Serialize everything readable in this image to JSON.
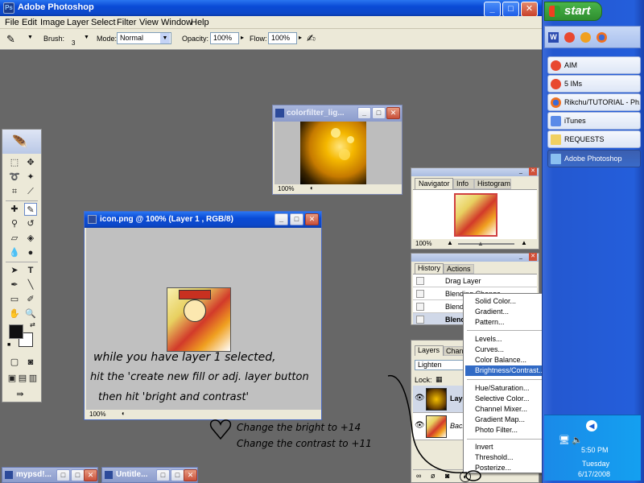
{
  "app": {
    "title": "Adobe Photoshop",
    "menu": [
      "File",
      "Edit",
      "Image",
      "Layer",
      "Select",
      "Filter",
      "View",
      "Window",
      "Help"
    ]
  },
  "options_bar": {
    "brush_label": "Brush:",
    "brush_size": "3",
    "mode_label": "Mode:",
    "mode_value": "Normal",
    "opacity_label": "Opacity:",
    "opacity_value": "100%",
    "flow_label": "Flow:",
    "flow_value": "100%"
  },
  "colorfilter_window": {
    "title": "colorfilter_lig...",
    "zoom": "100%"
  },
  "icon_window": {
    "title": "icon.png @ 100% (Layer 1 , RGB/8)",
    "zoom": "100%"
  },
  "navigator": {
    "tabs": [
      "Navigator",
      "Info",
      "Histogram"
    ],
    "zoom": "100%"
  },
  "history": {
    "tabs": [
      "History",
      "Actions"
    ],
    "items": [
      "Drag Layer",
      "Blending Change",
      "Blend",
      "Blend"
    ]
  },
  "layers": {
    "tabs": [
      "Layers",
      "Chann"
    ],
    "blend_mode": "Lighten",
    "lock_label": "Lock:",
    "layer_names": [
      "Laye",
      "Back"
    ]
  },
  "context_menu": {
    "group1": [
      "Solid Color...",
      "Gradient...",
      "Pattern..."
    ],
    "group2": [
      "Levels...",
      "Curves...",
      "Color Balance...",
      "Brightness/Contrast..."
    ],
    "group3": [
      "Hue/Saturation...",
      "Selective Color...",
      "Channel Mixer...",
      "Gradient Map...",
      "Photo Filter..."
    ],
    "group4": [
      "Invert",
      "Threshold...",
      "Posterize..."
    ],
    "highlighted": "Brightness/Contrast..."
  },
  "annotations": {
    "line1": "while you have layer 1 selected,",
    "line2": "hit the 'create new fill or adj. layer button",
    "line3": "then hit 'bright and contrast'",
    "line4": "Change the bright to +14",
    "line5": "Change the contrast to +11"
  },
  "minimized": [
    {
      "title": "mypsd!..."
    },
    {
      "title": "Untitle..."
    }
  ],
  "taskbar": {
    "start_label": "start",
    "items": [
      "AIM",
      "5 IMs",
      "Rikchu/TUTORIAL - Ph...",
      "iTunes",
      "REQUESTS",
      "Adobe Photoshop"
    ],
    "time": "5:50 PM",
    "day": "Tuesday",
    "date": "6/17/2008"
  },
  "colors": {
    "accent": "#316ac5",
    "xp_blue": "#0a4bd6",
    "start_green": "#3c9a3c",
    "workspace": "#676767"
  }
}
